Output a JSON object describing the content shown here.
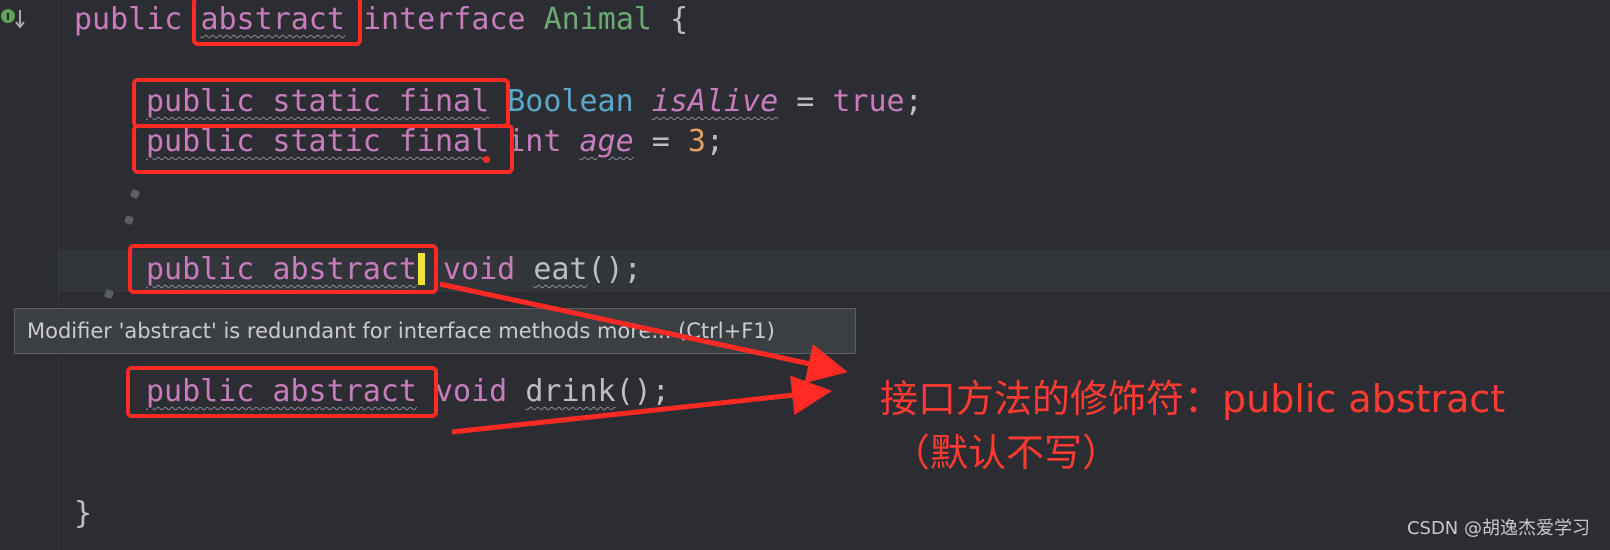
{
  "editor": {
    "line1": {
      "public": "public",
      "abstract": "abstract",
      "interface": "interface",
      "name": "Animal",
      "brace": "{"
    },
    "line2": {
      "modifiers": "public static final",
      "type": "Boolean",
      "ident": "isAlive",
      "eq": "=",
      "value": "true",
      "semi": ";"
    },
    "line3": {
      "modifiers": "public static final",
      "type": "int",
      "ident": "age",
      "eq": "=",
      "value": "3",
      "semi": ";"
    },
    "line4": {
      "modifiers": "public abstract",
      "type": "void",
      "method": "eat",
      "tail": "();"
    },
    "line5": {
      "modifiers": "public abstract",
      "type": "void",
      "method": "drink",
      "tail": "();"
    },
    "closing": "}"
  },
  "tooltip": {
    "text": "Modifier 'abstract' is redundant for interface methods more... (Ctrl+F1)"
  },
  "annotation": {
    "main": "接口方法的修饰符：public abstract",
    "sub": "（默认不写）"
  },
  "watermark": "CSDN @胡逸杰爱学习",
  "colors": {
    "background": "#2b2d32",
    "keyword": "#c77dbb",
    "highlight_box": "#ff2a24",
    "annotation_text": "#ff3a30"
  }
}
